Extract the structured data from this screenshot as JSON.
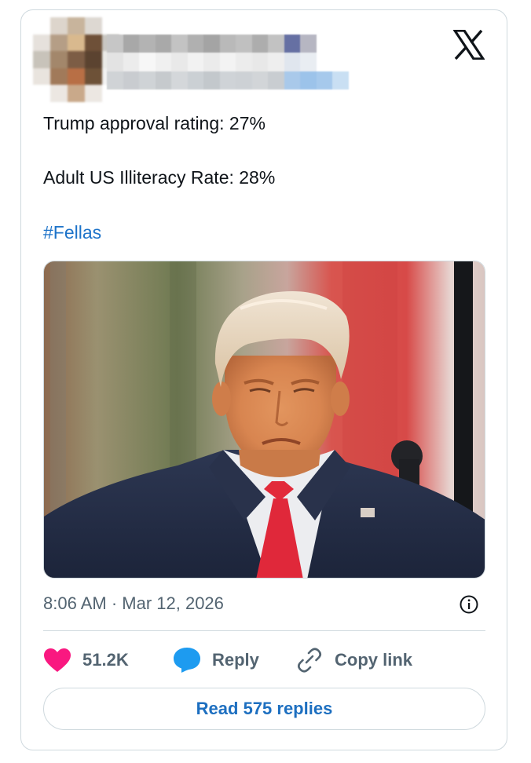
{
  "colors": {
    "text": "#0f1419",
    "secondary": "#536471",
    "link": "#1d73c9",
    "like": "#f91880",
    "reply": "#1d9bf0",
    "border": "#cfd9de"
  },
  "header": {
    "avatar_icon": "blurred-avatar",
    "author_icon": "blurred-author-name",
    "brand_icon": "x-logo-icon"
  },
  "tweet": {
    "line1": "Trump approval rating: 27%",
    "line2": "Adult US Illiteracy Rate: 28%",
    "hashtag": "#Fellas",
    "media_icon": "photo-of-man-in-suit-with-red-tie"
  },
  "meta": {
    "timestamp": "8:06 AM · Mar 12, 2026",
    "info_icon": "info-icon"
  },
  "actions": {
    "like_count": "51.2K",
    "reply_label": "Reply",
    "copy_label": "Copy link"
  },
  "footer": {
    "read_replies_label": "Read 575 replies"
  }
}
